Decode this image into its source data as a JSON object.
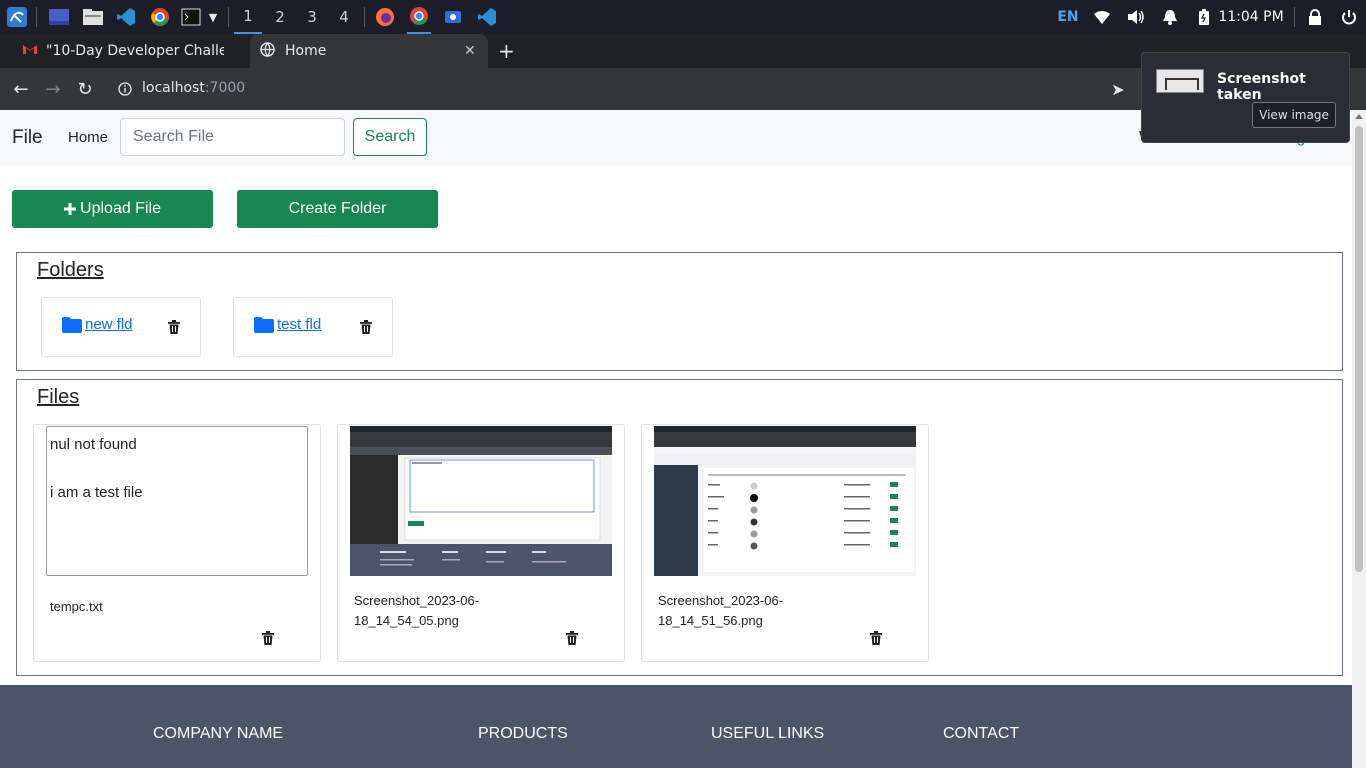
{
  "os": {
    "workspaces": [
      "1",
      "2",
      "3",
      "4"
    ],
    "active_workspace": "1",
    "language": "EN",
    "clock": "11:04 PM"
  },
  "browser": {
    "tabs": [
      {
        "title": "\"10-Day Developer Challe",
        "icon": "gmail-icon",
        "active": false
      },
      {
        "title": "Home",
        "icon": "globe-icon",
        "active": true
      }
    ],
    "url_host": "localhost",
    "url_port": ":7000"
  },
  "notification": {
    "title": "Screenshot taken",
    "button": "View image"
  },
  "app": {
    "brand": "File",
    "nav_home": "Home",
    "search_placeholder": "Search File",
    "search_button": "Search",
    "welcome": "Welcome testuser",
    "logout": "logout",
    "upload_button": "Upload File",
    "create_folder_button": "Create Folder",
    "folders_title": "Folders",
    "folders": [
      {
        "name": "new fld"
      },
      {
        "name": "test fld"
      }
    ],
    "files_title": "Files",
    "files": [
      {
        "name": "tempc.txt",
        "type": "text",
        "content": "nul not found\n\ni am a test file"
      },
      {
        "name": "Screenshot_2023-06-18_14_54_05.png",
        "name_line1": "Screenshot_2023-06-",
        "name_line2": "18_14_54_05.png",
        "type": "image"
      },
      {
        "name": "Screenshot_2023-06-18_14_51_56.png",
        "name_line1": "Screenshot_2023-06-",
        "name_line2": "18_14_51_56.png",
        "type": "image"
      }
    ]
  },
  "footer": {
    "headings": [
      "COMPANY NAME",
      "PRODUCTS",
      "USEFUL LINKS",
      "CONTACT"
    ]
  },
  "colors": {
    "primary_green": "#198754",
    "link_blue": "#0d6efd",
    "footer_bg": "#4b5469",
    "taskbar_bg": "#1b1e28"
  }
}
